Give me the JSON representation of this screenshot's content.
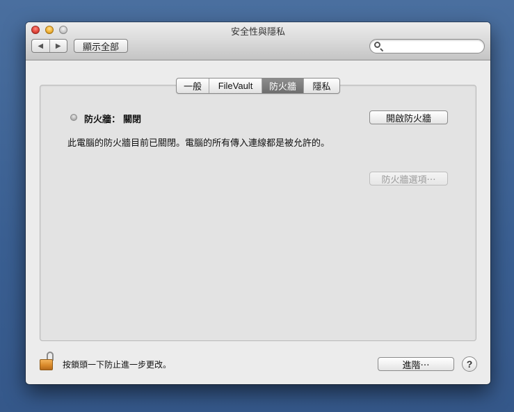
{
  "window": {
    "title": "安全性與隱私"
  },
  "toolbar": {
    "back_label": "◀",
    "forward_label": "▶",
    "show_all_label": "顯示全部",
    "search_placeholder": "",
    "search_value": ""
  },
  "tabs": [
    {
      "label": "一般",
      "active": false
    },
    {
      "label": "FileVault",
      "active": false
    },
    {
      "label": "防火牆",
      "active": true
    },
    {
      "label": "隱私",
      "active": false
    }
  ],
  "firewall": {
    "status_label": "防火牆：",
    "status_value": "關閉",
    "description": "此電腦的防火牆目前已關閉。電腦的所有傳入連線都是被允許的。",
    "turn_on_button": "開啟防火牆",
    "options_button": "防火牆選項⋯"
  },
  "footer": {
    "lock_text": "按鎖頭一下防止進一步更改。",
    "advanced_button": "進階⋯",
    "help_label": "?"
  },
  "colors": {
    "desktop": "#3c6193",
    "window_bg": "#ececec",
    "active_tab": "#7c7c7c",
    "lock": "#d98a2b"
  }
}
